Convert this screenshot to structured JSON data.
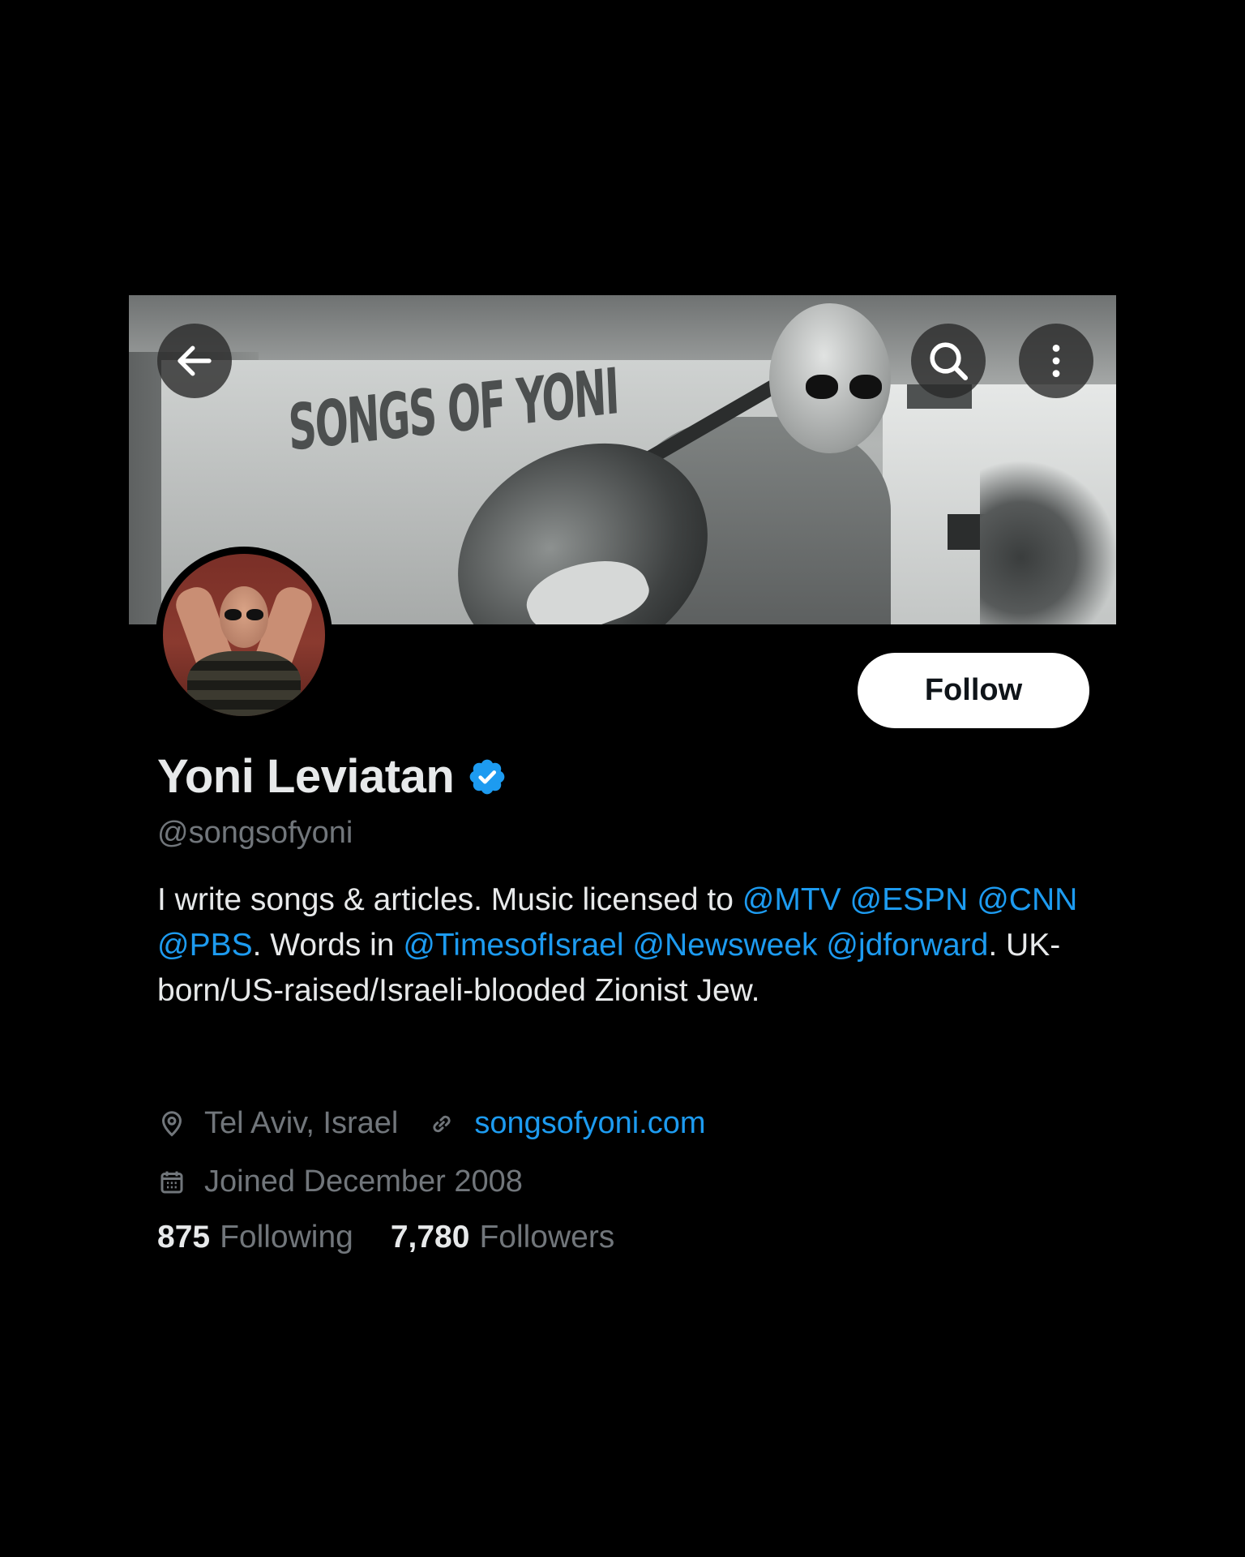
{
  "profile": {
    "banner_text": "SONGS OF YONI",
    "display_name": "Yoni Leviatan",
    "handle": "@songsofyoni",
    "bio": [
      {
        "text": "I write songs & articles. Music licensed to ",
        "type": "text"
      },
      {
        "text": "@MTV",
        "type": "mention"
      },
      {
        "text": " ",
        "type": "text"
      },
      {
        "text": "@ESPN",
        "type": "mention"
      },
      {
        "text": " ",
        "type": "text"
      },
      {
        "text": "@CNN",
        "type": "mention"
      },
      {
        "text": " ",
        "type": "text"
      },
      {
        "text": "@PBS",
        "type": "mention"
      },
      {
        "text": ". Words in ",
        "type": "text"
      },
      {
        "text": "@TimesofIsrael",
        "type": "mention"
      },
      {
        "text": " ",
        "type": "text"
      },
      {
        "text": "@Newsweek",
        "type": "mention"
      },
      {
        "text": " ",
        "type": "text"
      },
      {
        "text": "@jdforward",
        "type": "mention"
      },
      {
        "text": ". UK-born/US-raised/Israeli-blooded Zionist Jew.",
        "type": "text"
      }
    ],
    "location": "Tel Aviv, Israel",
    "website": "songsofyoni.com",
    "joined": "Joined December 2008",
    "following_count": "875",
    "following_label": "Following",
    "followers_count": "7,780",
    "followers_label": "Followers"
  },
  "actions": {
    "follow_label": "Follow",
    "back_icon": "arrow-left-icon",
    "search_icon": "search-icon",
    "more_icon": "more-vertical-icon"
  },
  "colors": {
    "background": "#000000",
    "accent": "#1d9bf0",
    "primary_text": "#e7e9ea",
    "secondary_text": "#71767b",
    "follow_bg": "#ffffff"
  }
}
